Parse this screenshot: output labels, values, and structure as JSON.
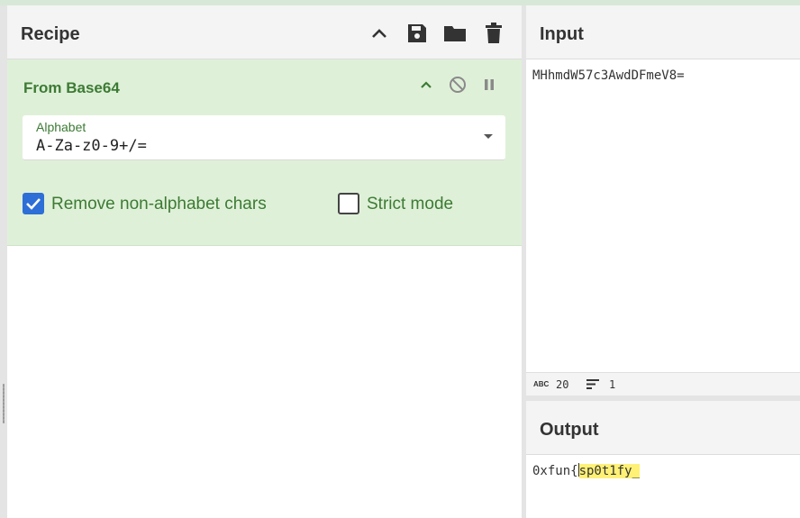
{
  "recipe": {
    "title": "Recipe",
    "header_icons": [
      "chevron-up-icon",
      "save-icon",
      "folder-icon",
      "trash-icon"
    ]
  },
  "operation": {
    "title": "From Base64",
    "alphabet_label": "Alphabet",
    "alphabet_value": "A-Za-z0-9+/=",
    "remove_nonalpha": {
      "label": "Remove non-alphabet chars",
      "checked": true
    },
    "strict_mode": {
      "label": "Strict mode",
      "checked": false
    }
  },
  "input": {
    "title": "Input",
    "text": "MHhmdW57c3AwdDFmeV8=",
    "status": {
      "length": "20",
      "lines": "1",
      "abc_icon": "ABC"
    }
  },
  "output": {
    "title": "Output",
    "text_plain": "0xfun{",
    "text_highlighted": "sp0t1fy_"
  },
  "colors": {
    "accent_green": "#3c7b34",
    "operation_bg": "#dff0d8",
    "checkbox_blue": "#2d6fd6",
    "highlight": "#fff176"
  }
}
